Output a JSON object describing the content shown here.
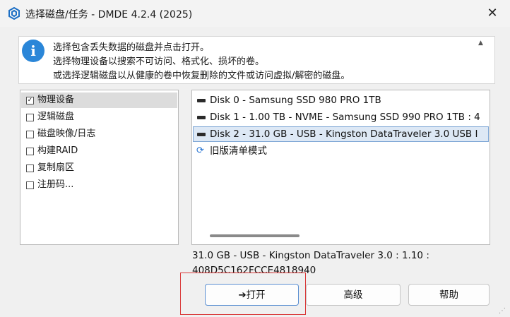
{
  "window": {
    "title": "选择磁盘/任务 - DMDE 4.2.4 (2025)",
    "close_glyph": "✕",
    "app_icon": "dmde-logo-icon"
  },
  "info": {
    "icon": "i",
    "lines": [
      "选择包含丢失数据的磁盘并点击打开。",
      "选择物理设备以搜索不可访问、格式化、损坏的卷。",
      "或选择逻辑磁盘以从健康的卷中恢复删除的文件或访问虚拟/解密的磁盘。"
    ]
  },
  "left_list": {
    "items": [
      {
        "label": "物理设备",
        "checked": true,
        "selected": true
      },
      {
        "label": "逻辑磁盘",
        "checked": false,
        "selected": false
      },
      {
        "label": "磁盘映像/日志",
        "checked": false,
        "selected": false
      },
      {
        "label": "构建RAID",
        "checked": false,
        "selected": false
      },
      {
        "label": "复制扇区",
        "checked": false,
        "selected": false
      },
      {
        "label": "注册码...",
        "checked": false,
        "selected": false
      }
    ]
  },
  "disk_list": {
    "items": [
      {
        "label": "Disk 0 - Samsung SSD 980 PRO 1TB",
        "icon": "drive-icon",
        "selected": false
      },
      {
        "label": "Disk 1 - 1.00 TB - NVME - Samsung SSD 990 PRO 1TB : 4",
        "icon": "drive-icon",
        "selected": false
      },
      {
        "label": "Disk 2 - 31.0 GB - USB - Kingston DataTraveler 3.0 USB I",
        "icon": "drive-icon",
        "selected": true
      },
      {
        "label": "旧版清单模式",
        "icon": "refresh-icon",
        "selected": false
      }
    ]
  },
  "details": {
    "line1": "31.0 GB - USB - Kingston DataTraveler 3.0 : 1.10 :",
    "line2": "408D5C162FCCE4818940"
  },
  "buttons": {
    "open_arrow": "➔",
    "open": "打开",
    "advanced": "高级",
    "help": "帮助"
  },
  "colors": {
    "accent": "#2a86d8",
    "highlight_box": "#d93a3a",
    "selection": "#dde8f5"
  }
}
